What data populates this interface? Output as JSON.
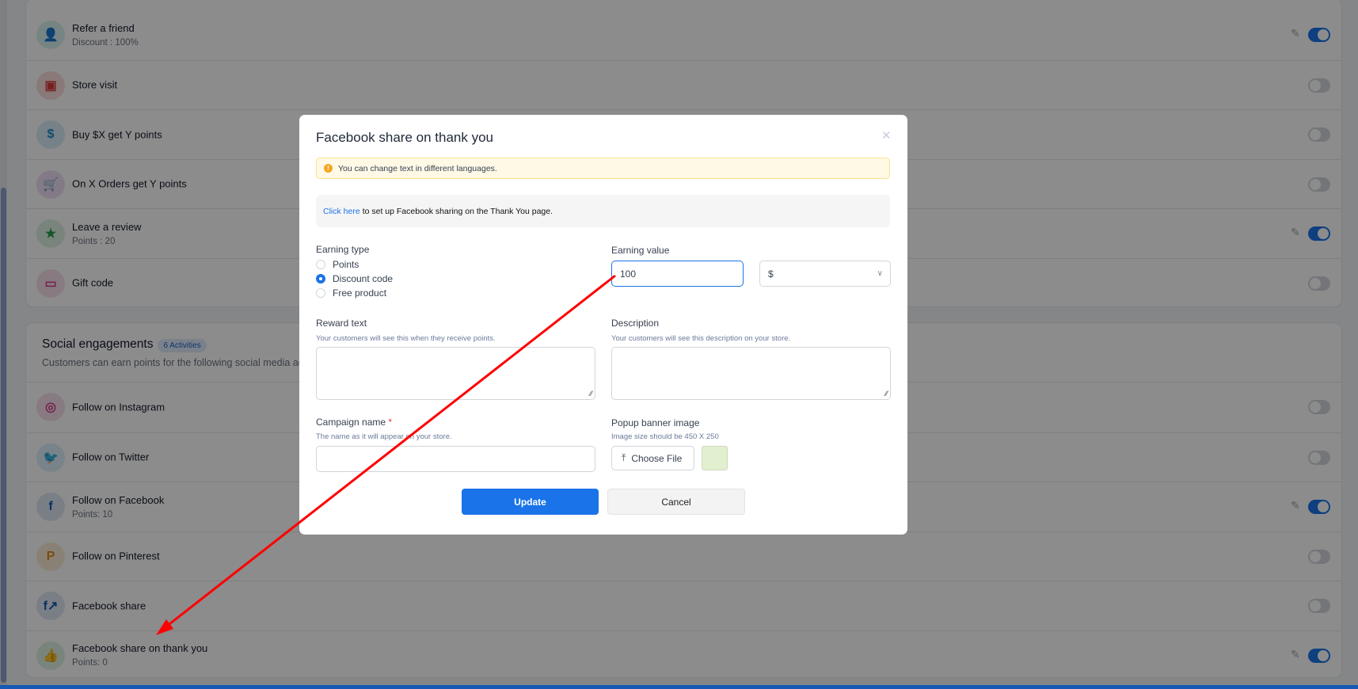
{
  "ways_to_earn": [
    {
      "title": "Refer a friend",
      "sub": "Discount : 100%",
      "icon": "refer-friend-icon",
      "color": "#14a39a",
      "bg": "#d8f2ef",
      "enabled": true,
      "editable": true
    },
    {
      "title": "Store visit",
      "sub": "",
      "icon": "store-visit-icon",
      "color": "#d63b3b",
      "bg": "#fadcdc",
      "enabled": false,
      "editable": false
    },
    {
      "title": "Buy $X get Y points",
      "sub": "",
      "icon": "dollar-icon",
      "color": "#1e88c8",
      "bg": "#d8ecf8",
      "enabled": false,
      "editable": false
    },
    {
      "title": "On X Orders get Y points",
      "sub": "",
      "icon": "cart-icon",
      "color": "#a54bd1",
      "bg": "#efdff8",
      "enabled": false,
      "editable": false
    },
    {
      "title": "Leave a review",
      "sub": "Points : 20",
      "icon": "review-stars-icon",
      "color": "#2f9a4f",
      "bg": "#dcf2e2",
      "enabled": true,
      "editable": true
    },
    {
      "title": "Gift code",
      "sub": "",
      "icon": "gift-code-icon",
      "color": "#d6408a",
      "bg": "#f8dfec",
      "enabled": false,
      "editable": false
    }
  ],
  "social": {
    "title": "Social engagements",
    "badge": "6 Activities",
    "subtitle": "Customers can earn points for the following social media activities",
    "items": [
      {
        "title": "Follow on Instagram",
        "sub": "",
        "icon": "instagram-icon",
        "glyph": "◎",
        "color": "#d6408a",
        "bg": "#f8dfec",
        "enabled": false,
        "editable": false
      },
      {
        "title": "Follow on Twitter",
        "sub": "",
        "icon": "twitter-icon",
        "glyph": "🐦",
        "color": "#1da1f2",
        "bg": "#dbeefb",
        "enabled": false,
        "editable": false
      },
      {
        "title": "Follow on Facebook",
        "sub": "Points: 10",
        "icon": "facebook-icon",
        "glyph": "f",
        "color": "#1559b5",
        "bg": "#dfe8f5",
        "enabled": true,
        "editable": true
      },
      {
        "title": "Follow on Pinterest",
        "sub": "",
        "icon": "pinterest-icon",
        "glyph": "P",
        "color": "#e08a1e",
        "bg": "#fbecd8",
        "enabled": false,
        "editable": false
      },
      {
        "title": "Facebook share",
        "sub": "",
        "icon": "facebook-share-icon",
        "glyph": "f↗",
        "color": "#1559b5",
        "bg": "#dfe8f5",
        "enabled": false,
        "editable": false
      },
      {
        "title": "Facebook share on thank you",
        "sub": "Points: 0",
        "icon": "thumbs-up-icon",
        "glyph": "👍",
        "color": "#2f9a4f",
        "bg": "#dcf2e2",
        "enabled": true,
        "editable": true
      }
    ]
  },
  "modal": {
    "title": "Facebook share on thank you",
    "alert": "You can change text in different languages.",
    "info_link": "Click here",
    "info_text": "to set up Facebook sharing on the Thank You page.",
    "earning_type_label": "Earning type",
    "earning_types": [
      "Points",
      "Discount code",
      "Free product"
    ],
    "earning_type_selected": "Discount code",
    "earning_value_label": "Earning value",
    "earning_value": "100",
    "currency": "$",
    "reward_label": "Reward text",
    "reward_help": "Your customers will see this when they receive points.",
    "desc_label": "Description",
    "desc_help": "Your customers will see this description on your store.",
    "campaign_label": "Campaign name",
    "required": "*",
    "campaign_help": "The name as it will appear on your store.",
    "banner_label": "Popup banner image",
    "banner_help": "Image size should be 450 X 250",
    "choose_file": "Choose File",
    "update": "Update",
    "cancel": "Cancel"
  }
}
